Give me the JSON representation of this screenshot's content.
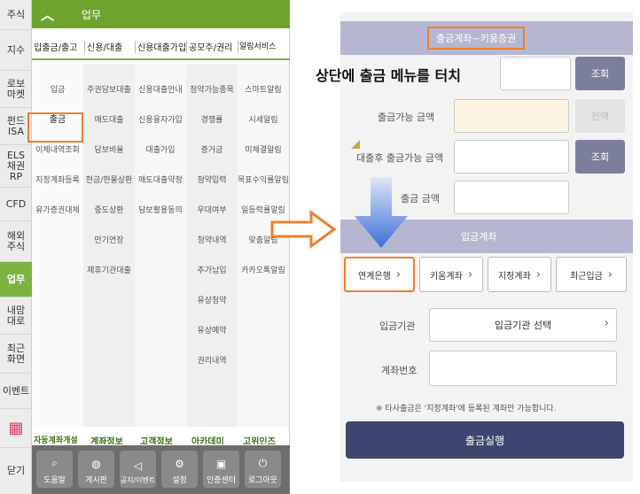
{
  "left_app": {
    "nav": [
      "주식",
      "지수",
      "로보\n마켓",
      "펀드\nISA",
      "ELS\n채권\nRP",
      "CFD",
      "해외\n주식",
      "업무",
      "내맘\n대로",
      "최근\n화면",
      "이벤트",
      "닫기"
    ],
    "active_nav": "업무",
    "header_title": "업무",
    "categories": [
      "입출금/출고",
      "신용/대출",
      "신용대출가입",
      "공모주/권리",
      "알림서비스"
    ],
    "menu_columns": [
      [
        "입금",
        "출금",
        "이체내역조회",
        "지정계좌등록",
        "유가증권대체"
      ],
      [
        "주권담보대출",
        "매도대출",
        "담보비율",
        "현금/현물상환",
        "중도상환",
        "만기연장",
        "제휴기관대출"
      ],
      [
        "신용대출안내",
        "신용융자가입",
        "대출가입",
        "매도대출약정",
        "담보활용동의"
      ],
      [
        "청약가능종목",
        "경쟁률",
        "증거금",
        "청약입력",
        "우대여부",
        "청약내역",
        "추가납입",
        "유상청약",
        "유상예약",
        "권리내역"
      ],
      [
        "스마트알림",
        "시세알림",
        "미체결알림",
        "목표수익률알림",
        "일등락률알림",
        "맞춤알림",
        "카카오톡알림"
      ]
    ],
    "bottom_categories": [
      "자동계좌개설",
      "계좌정보",
      "고객정보",
      "아카데미",
      "고위인즈"
    ],
    "bottom_buttons": [
      {
        "icon": "search-icon",
        "label": "도움말"
      },
      {
        "icon": "chat-icon",
        "label": "게시판"
      },
      {
        "icon": "speaker-icon",
        "label": "공지/이벤트"
      },
      {
        "icon": "gear-icon",
        "label": "설정"
      },
      {
        "icon": "lock-icon",
        "label": "인증센터"
      },
      {
        "icon": "power-icon",
        "label": "로그아웃"
      }
    ]
  },
  "right_app": {
    "callout": "상단에 출금 메뉴를 터치",
    "header_title": "출금계좌~키움증권",
    "inquiry_button": "조회",
    "rows": [
      {
        "label": "출금가능 금액",
        "button": "전액"
      },
      {
        "label": "대출후 출금가능 금액",
        "button": "조회"
      },
      {
        "label": "출금 금액",
        "button": ""
      }
    ],
    "section2_title": "입금계좌",
    "tabs": [
      "연계은행",
      "키움계좌",
      "지정계좌",
      "최근입금"
    ],
    "bank_label": "입금기관",
    "bank_select": "입금기관 선택",
    "account_label": "계좌번호",
    "notice": "※ 타사출금은 '지정계좌'에 등록된 계좌만 가능합니다.",
    "submit": "출금실행"
  }
}
